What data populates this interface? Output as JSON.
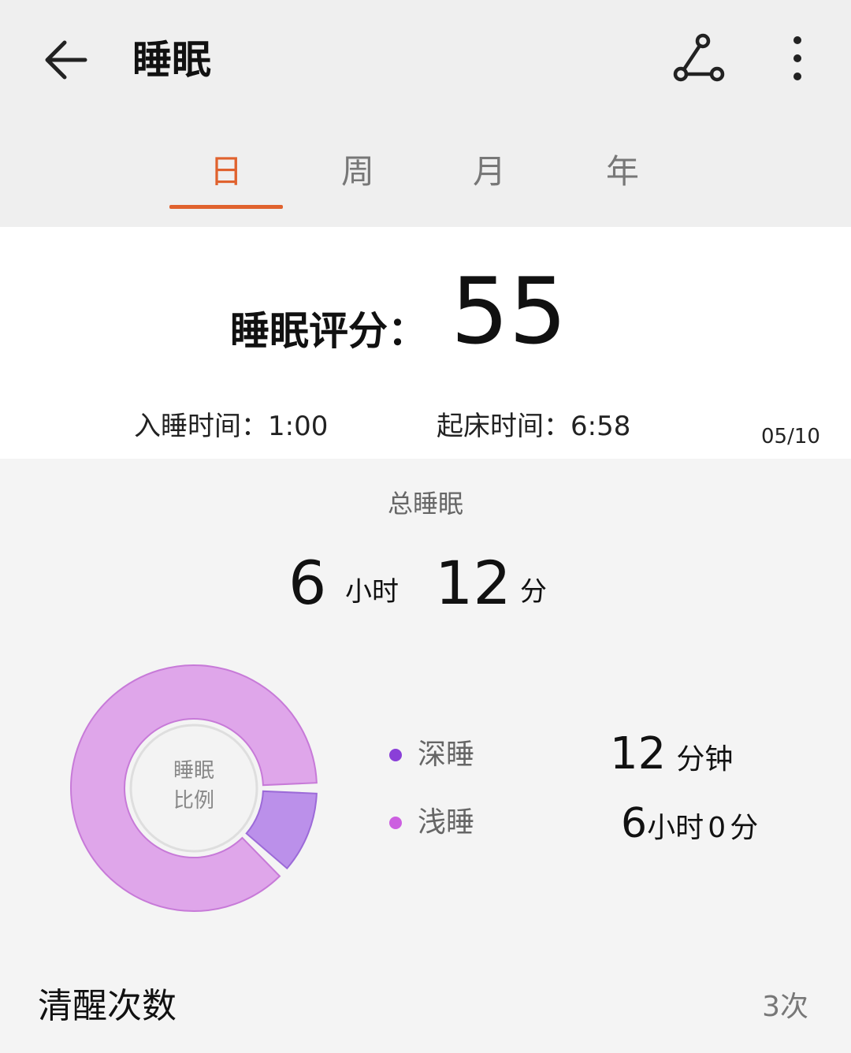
{
  "header": {
    "title": "睡眠",
    "back_icon": "arrow-left-icon",
    "share_icon": "share-graph-icon",
    "more_icon": "more-vertical-icon"
  },
  "tabs": [
    {
      "label": "日",
      "active": true
    },
    {
      "label": "周",
      "active": false
    },
    {
      "label": "月",
      "active": false
    },
    {
      "label": "年",
      "active": false
    }
  ],
  "score": {
    "label": "睡眠评分：",
    "value": "55"
  },
  "times": {
    "sleep_label": "入睡时间：",
    "sleep_value": "1:00",
    "wake_label": "起床时间：",
    "wake_value": "6:58",
    "date": "05/10"
  },
  "total": {
    "label": "总睡眠",
    "hours": "6",
    "hours_unit": "小时",
    "minutes": "12",
    "minutes_unit": "分"
  },
  "ratio": {
    "center_line1": "睡眠",
    "center_line2": "比例",
    "colors": {
      "light": "#dfa6ea",
      "deep": "#bb90ea",
      "dot_deep": "#8a3fd8",
      "dot_light": "#cc5fe0"
    },
    "deep": {
      "label": "深睡",
      "value_num": "12",
      "value_unit": "分钟",
      "fraction": 0.12
    },
    "light": {
      "label": "浅睡",
      "hours_num": "6",
      "hours_unit": "小时",
      "minutes_num": "0",
      "minutes_unit": "分",
      "fraction": 0.88
    }
  },
  "wake_count": {
    "label": "清醒次数",
    "value": "3次"
  }
}
